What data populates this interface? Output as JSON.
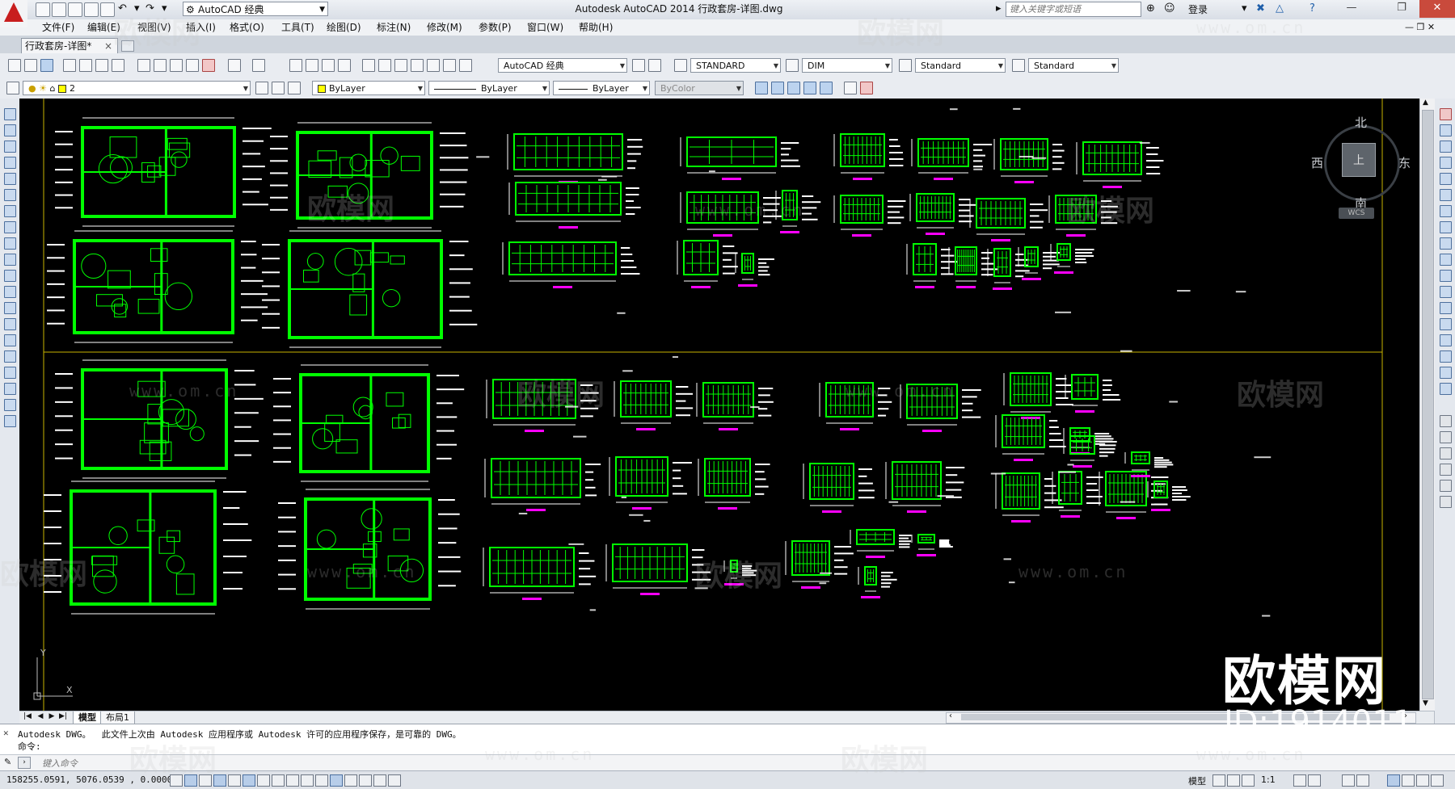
{
  "app": {
    "title": "Autodesk AutoCAD 2014    行政套房-详图.dwg",
    "workspace": "AutoCAD 经典",
    "search_placeholder": "键入关键字或短语",
    "login_label": "登录",
    "file_tab": "行政套房-详图*"
  },
  "menu": [
    "文件(F)",
    "编辑(E)",
    "视图(V)",
    "插入(I)",
    "格式(O)",
    "工具(T)",
    "绘图(D)",
    "标注(N)",
    "修改(M)",
    "参数(P)",
    "窗口(W)",
    "帮助(H)"
  ],
  "toolbar": {
    "workspace_combo": "AutoCAD 经典",
    "text_style": "STANDARD",
    "dim_style": "DIM",
    "table_style": "Standard",
    "mleader_style": "Standard",
    "layer": "2",
    "color": "ByLayer",
    "linetype": "ByLayer",
    "lineweight": "ByLayer",
    "plotstyle": "ByColor"
  },
  "viewcube": {
    "north": "北",
    "south": "南",
    "east": "东",
    "west": "西",
    "top_face": "上",
    "wcs": "WCS"
  },
  "watermark": {
    "brand": "欧模网",
    "url": "www.om.cn",
    "big_logo": "欧模网",
    "id_text": "ID:1914011"
  },
  "layout_tabs": [
    "模型",
    "布局1"
  ],
  "command": {
    "history_line1": "Autodesk DWG。  此文件上次由 Autodesk 应用程序或 Autodesk 许可的应用程序保存，是可靠的 DWG。",
    "history_line2": "命令:",
    "input_placeholder": "键入命令"
  },
  "status": {
    "coordinates": "158255.0591, 5076.0539 , 0.0000",
    "model_label": "模型",
    "scale_label": "1:1"
  },
  "colors": {
    "canvas": "#000000",
    "drawing": "#00ff00",
    "frame": "#c8b400",
    "accent_red": "#c81e1e"
  }
}
